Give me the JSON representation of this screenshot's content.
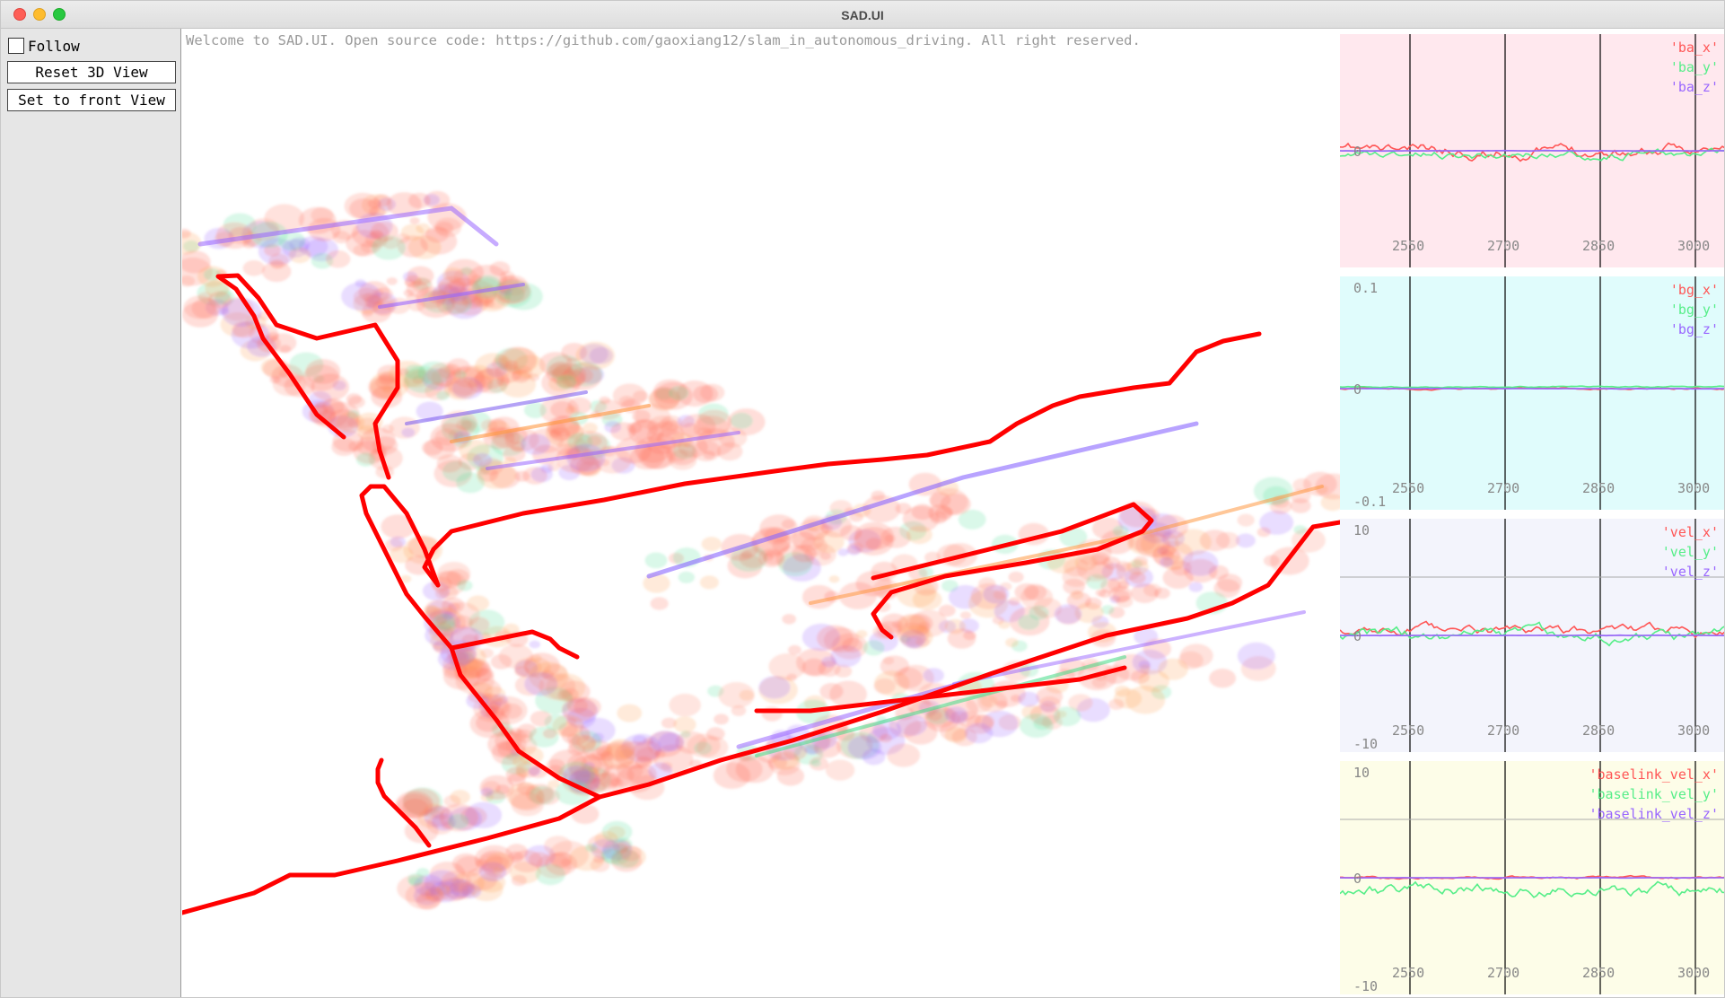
{
  "window": {
    "title": "SAD.UI"
  },
  "panel": {
    "follow_label": "Follow",
    "follow_checked": false,
    "reset_label": "Reset 3D View",
    "front_label": "Set to front View"
  },
  "viewer": {
    "welcome": "Welcome to SAD.UI. Open source code: https://github.com/gaoxiang12/slam_in_autonomous_driving. All right reserved.",
    "trajectory_color": "#ff0000"
  },
  "plots": [
    {
      "legend": [
        "'ba_x'",
        "'ba_y'",
        "'ba_z'"
      ],
      "y_labels": [
        "0"
      ],
      "x_ticks": [
        "2550",
        "2700",
        "2850",
        "3000"
      ],
      "bg": "#ffe8ee"
    },
    {
      "legend": [
        "'bg_x'",
        "'bg_y'",
        "'bg_z'"
      ],
      "y_labels": [
        "0.1",
        "0",
        "-0.1"
      ],
      "x_ticks": [
        "2550",
        "2700",
        "2850",
        "3000"
      ],
      "bg": "#e0fcfc"
    },
    {
      "legend": [
        "'vel_x'",
        "'vel_y'",
        "'vel_z'"
      ],
      "y_labels": [
        "10",
        "0",
        "-10"
      ],
      "x_ticks": [
        "2550",
        "2700",
        "2850",
        "3000"
      ],
      "bg": "#f3f4fc"
    },
    {
      "legend": [
        "'baselink_vel_x'",
        "'baselink_vel_y'",
        "'baselink_vel_z'"
      ],
      "y_labels": [
        "10",
        "0",
        "-10"
      ],
      "x_ticks": [
        "2550",
        "2700",
        "2850",
        "3000"
      ],
      "bg": "#fdfde8"
    }
  ],
  "series_colors": [
    "#ff5555",
    "#55ee88",
    "#9966ff"
  ]
}
